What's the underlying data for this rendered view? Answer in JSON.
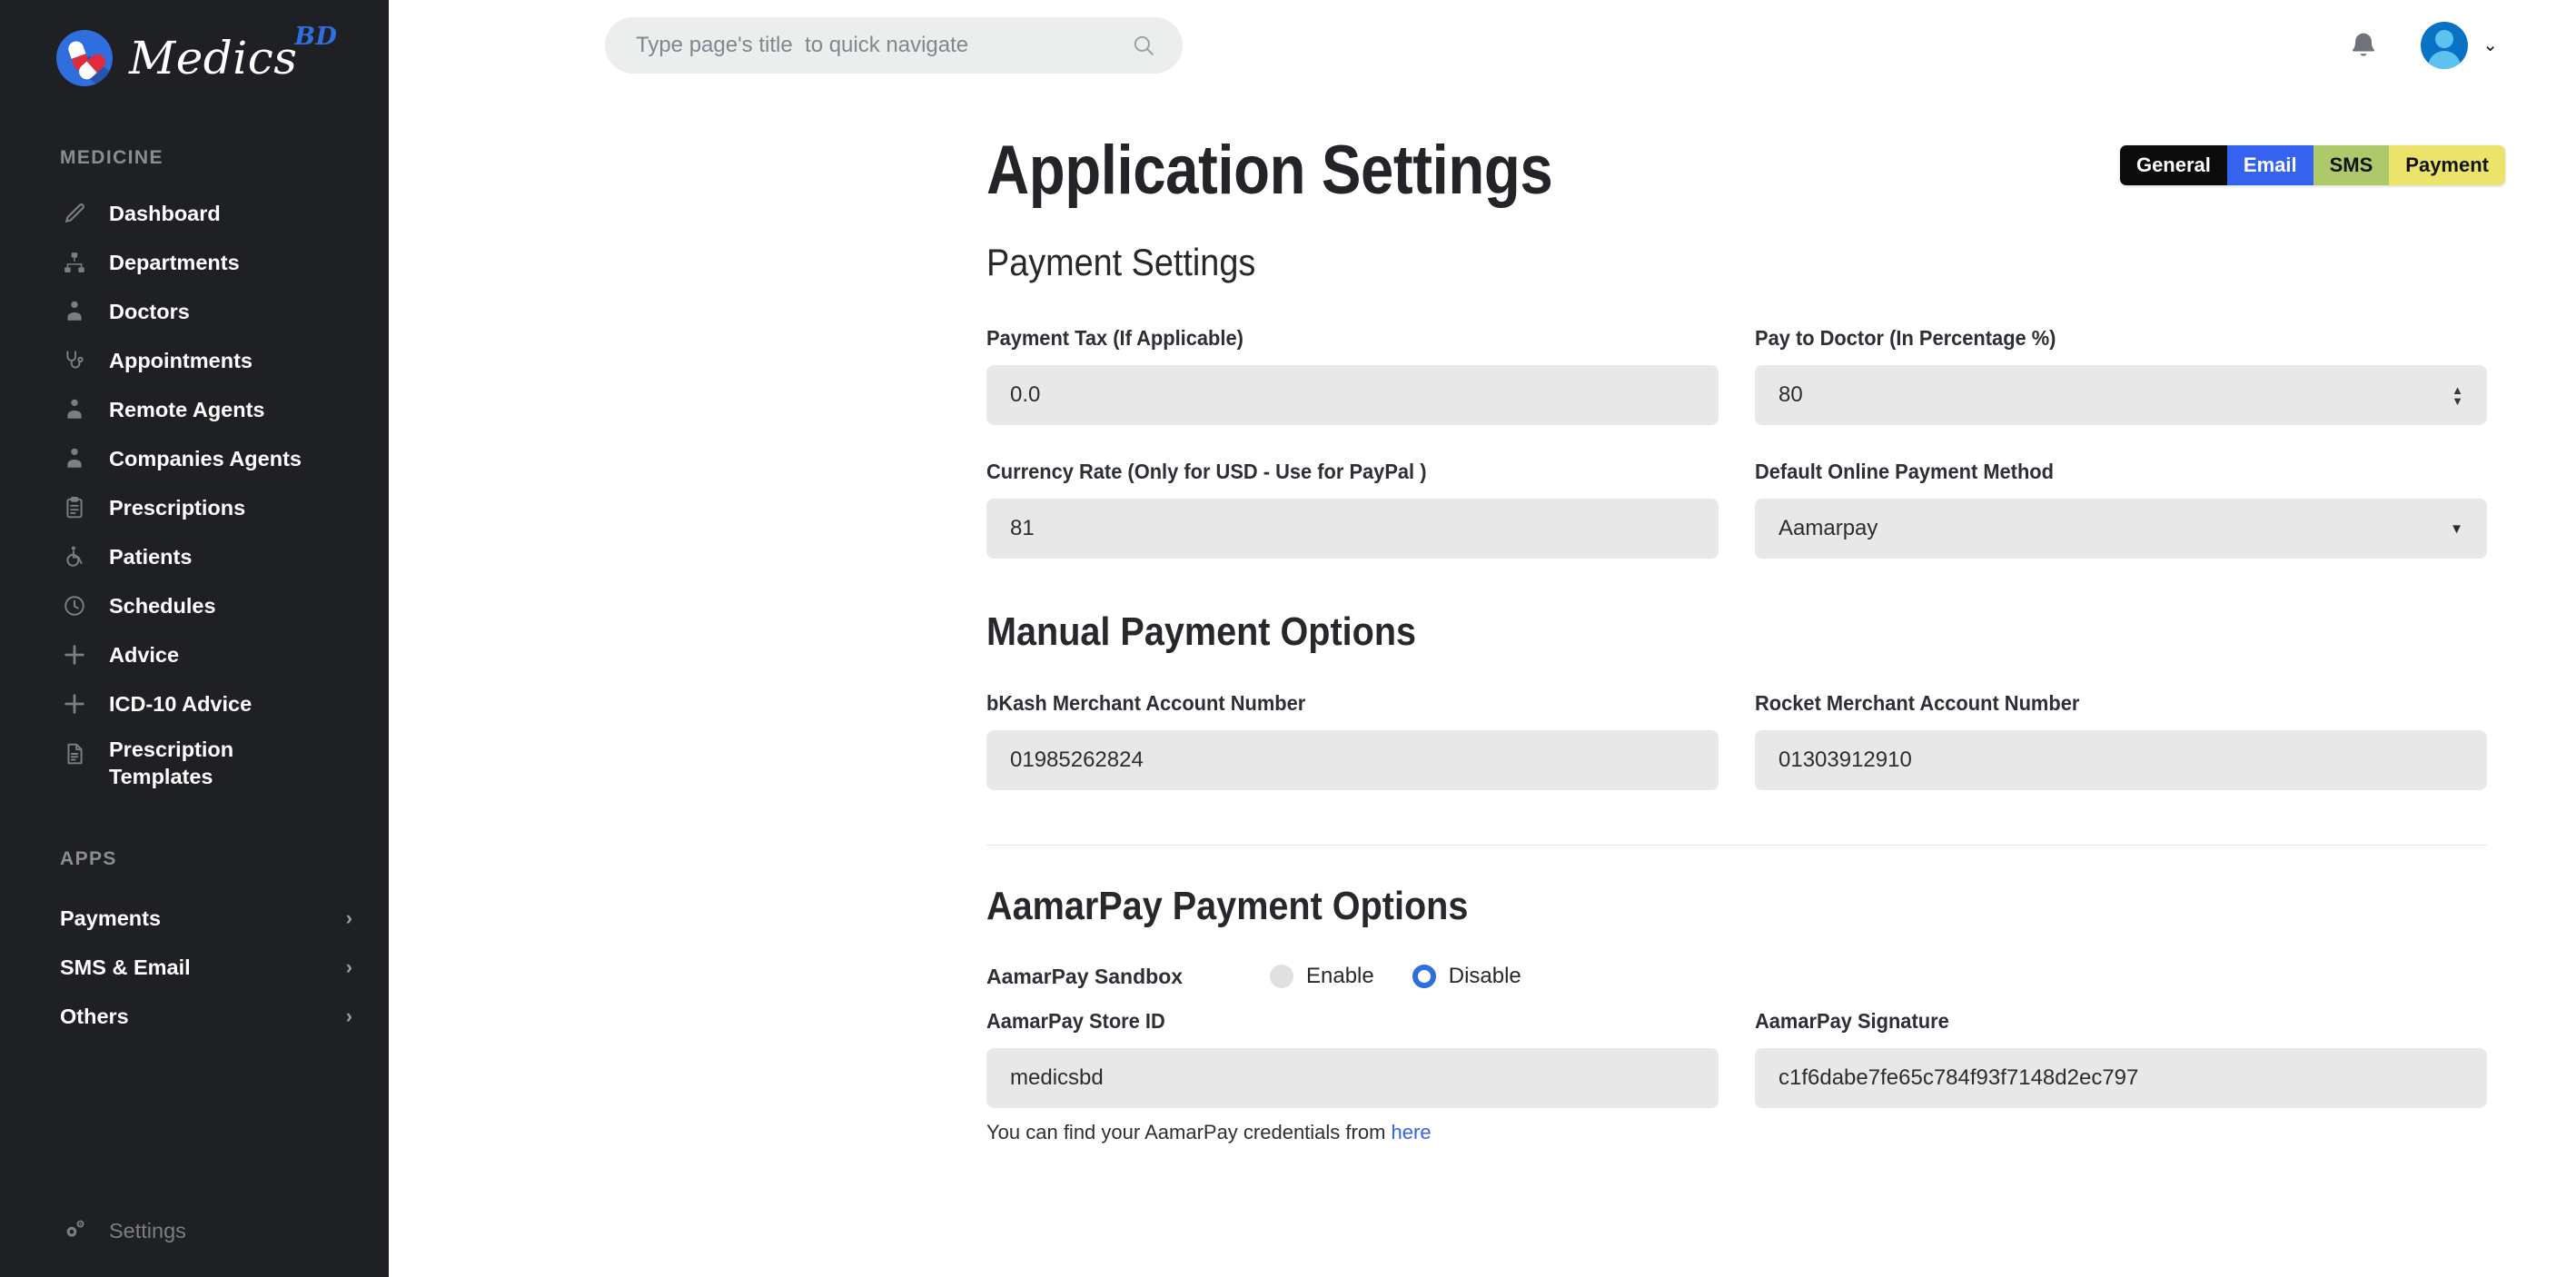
{
  "brand": {
    "name": "Medics",
    "superscript": "BD"
  },
  "sidebar": {
    "section_medicine": "MEDICINE",
    "items": [
      {
        "label": "Dashboard",
        "icon": "thermometer-icon"
      },
      {
        "label": "Departments",
        "icon": "org-chart-icon"
      },
      {
        "label": "Doctors",
        "icon": "doctor-icon"
      },
      {
        "label": "Appointments",
        "icon": "stethoscope-icon"
      },
      {
        "label": "Remote Agents",
        "icon": "doctor-icon"
      },
      {
        "label": "Companies Agents",
        "icon": "doctor-icon"
      },
      {
        "label": "Prescriptions",
        "icon": "clipboard-icon"
      },
      {
        "label": "Patients",
        "icon": "wheelchair-icon"
      },
      {
        "label": "Schedules",
        "icon": "clock-icon"
      },
      {
        "label": "Advice",
        "icon": "plus-icon"
      },
      {
        "label": "ICD-10 Advice",
        "icon": "plus-icon"
      },
      {
        "label": "Prescription Templates",
        "icon": "document-icon"
      }
    ],
    "section_apps": "APPS",
    "apps": [
      {
        "label": "Payments",
        "chevron": "›"
      },
      {
        "label": "SMS & Email",
        "chevron": "›"
      },
      {
        "label": "Others",
        "chevron": "›"
      }
    ],
    "settings": {
      "label": "Settings",
      "icon": "gear-icon"
    }
  },
  "topbar": {
    "search": {
      "value": "",
      "placeholder": "Type page's title  to quick navigate",
      "icon": "search-icon"
    },
    "notifications_icon": "bell-icon",
    "avatar_icon": "user-avatar",
    "caret": "⌄"
  },
  "tabs": [
    {
      "label": "General",
      "bg": "#0c0c0d",
      "fg": "#ffffff"
    },
    {
      "label": "Email",
      "bg": "#3563f0",
      "fg": "#ffffff"
    },
    {
      "label": "SMS",
      "bg": "#aec96a",
      "fg": "#111315"
    },
    {
      "label": "Payment",
      "bg": "#ece46a",
      "fg": "#111315"
    }
  ],
  "page": {
    "title": "Application Settings",
    "payment_settings_title": "Payment Settings",
    "manual_title": "Manual Payment Options",
    "aamarpay_title": "AamarPay Payment Options"
  },
  "fields": {
    "payment_tax": {
      "label": "Payment Tax (If Applicable)",
      "value": "0.0"
    },
    "pay_to_doctor": {
      "label": "Pay to Doctor (In Percentage %)",
      "value": "80"
    },
    "currency_rate": {
      "label": "Currency Rate (Only for USD - Use for PayPal )",
      "value": "81"
    },
    "default_payment_method": {
      "label": "Default Online Payment Method",
      "value": "Aamarpay",
      "caret": "▼"
    },
    "bkash": {
      "label": "bKash Merchant Account Number",
      "value": "01985262824"
    },
    "rocket": {
      "label": "Rocket Merchant Account Number",
      "value": "01303912910"
    },
    "sandbox": {
      "label": "AamarPay Sandbox",
      "enable_label": "Enable",
      "disable_label": "Disable",
      "selected": "Disable"
    },
    "store_id": {
      "label": "AamarPay Store ID",
      "value": "medicsbd"
    },
    "signature": {
      "label": "AamarPay Signature",
      "value": "c1f6dabe7fe65c784f93f7148d2ec797"
    },
    "helper_text": "You can find your AamarPay credentials from ",
    "helper_link": "here"
  }
}
